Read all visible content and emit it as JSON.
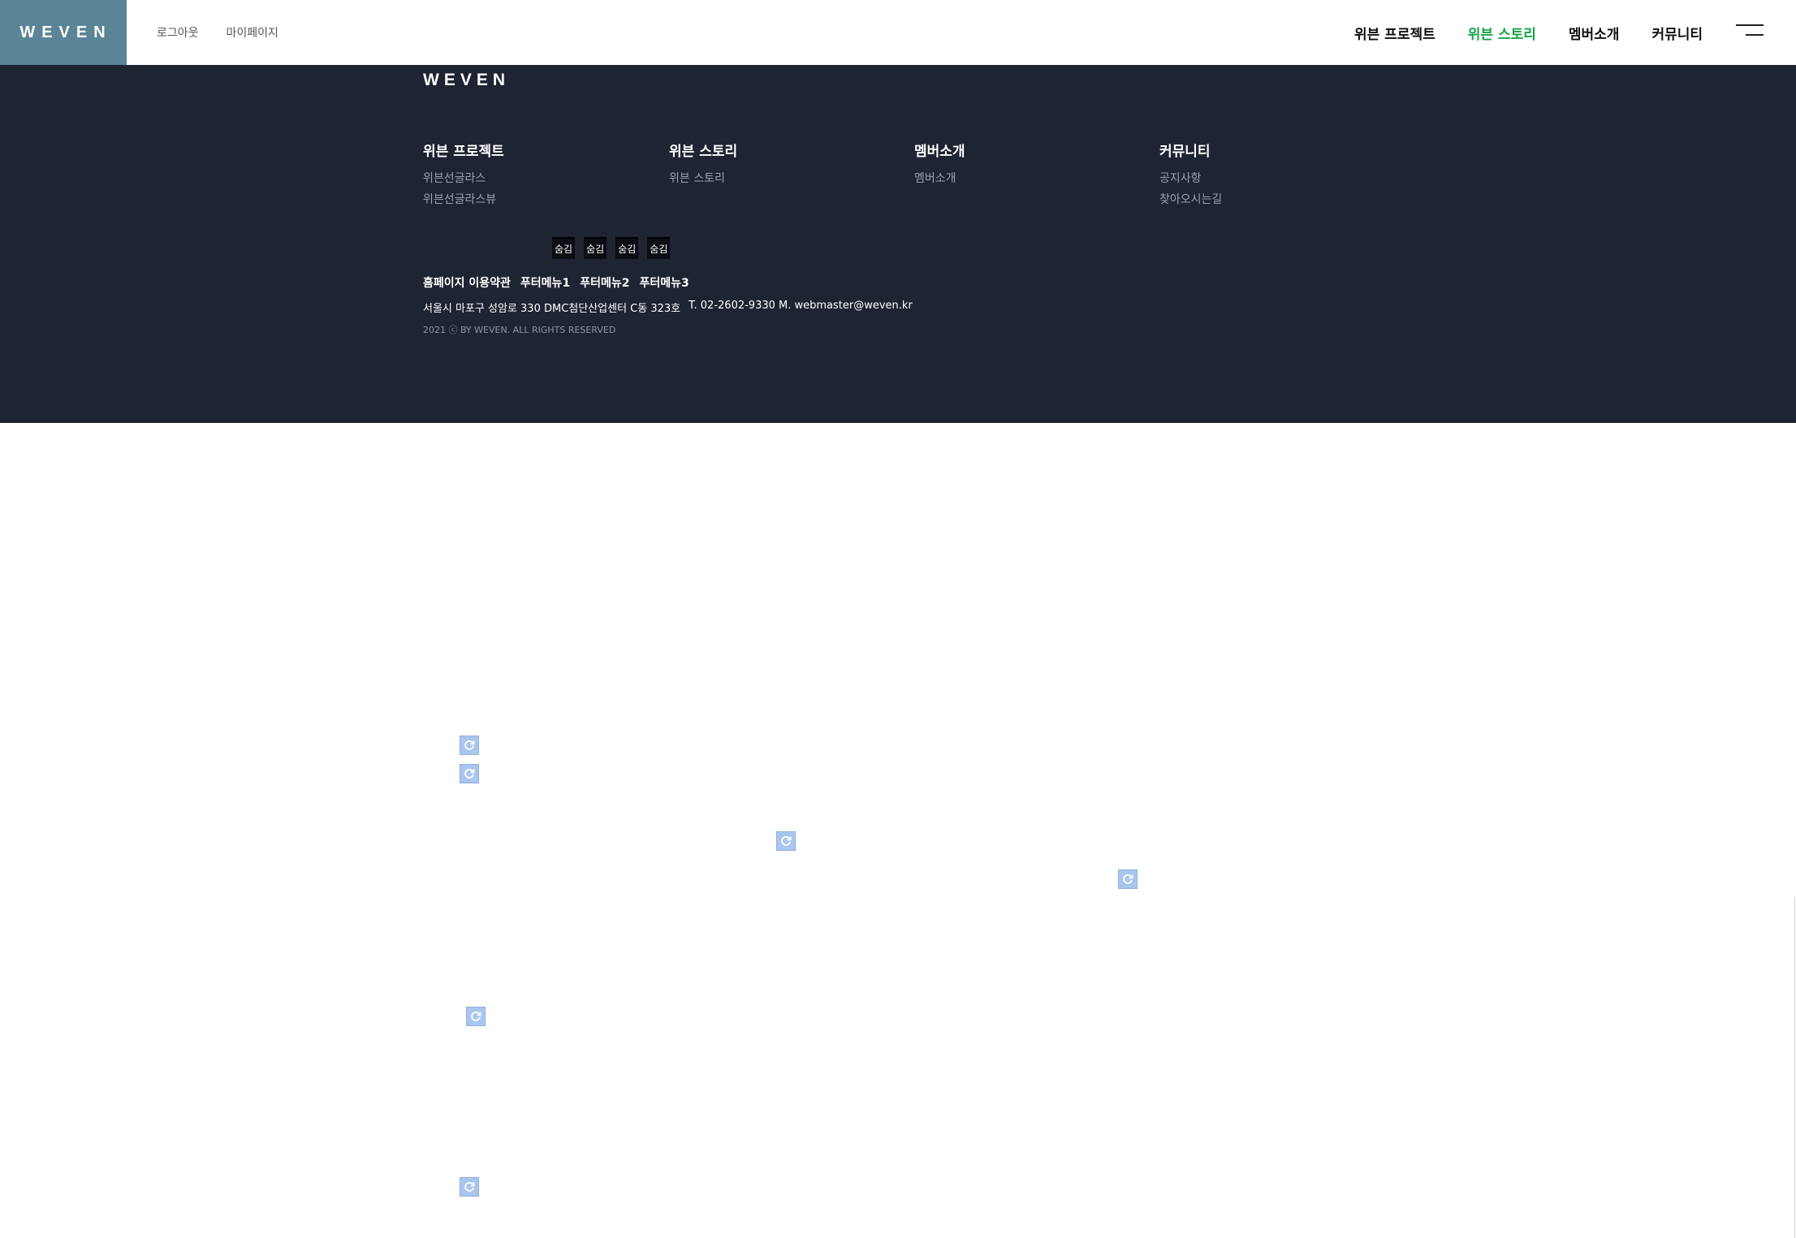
{
  "header": {
    "logo": "WEVEN",
    "util_links": [
      "로그아웃",
      "마이페이지"
    ],
    "nav": [
      {
        "label": "위븐 프로젝트",
        "active": false
      },
      {
        "label": "위븐 스토리",
        "active": true
      },
      {
        "label": "멤버소개",
        "active": false
      },
      {
        "label": "커뮤니티",
        "active": false
      }
    ],
    "active_color": "#1aa24a"
  },
  "footer": {
    "logo": "WEVEN",
    "columns": [
      {
        "title": "위븐 프로젝트",
        "links": [
          "위븐선글라스",
          "위븐선글라스뷰"
        ]
      },
      {
        "title": "위븐 스토리",
        "links": [
          "위븐 스토리"
        ]
      },
      {
        "title": "멤버소개",
        "links": [
          "멤버소개"
        ]
      },
      {
        "title": "커뮤니티",
        "links": [
          "공지사항",
          "찾아오시는길"
        ]
      }
    ],
    "hide_tags": [
      "숨김",
      "숨김",
      "숨김",
      "숨김"
    ],
    "menu": [
      "홈페이지 이용약관",
      "푸터메뉴1",
      "푸터메뉴2",
      "푸터메뉴3"
    ],
    "address": "서울시 마포구 성암로 330 DMC첨단산업센터 C동 323호",
    "contact": "T. 02-2602-9330 M. webmaster@weven.kr",
    "copyright": "2021 ⓒ BY WEVEN. ALL RIGHTS RESERVED",
    "background": "#1f2432"
  },
  "placeholders": {
    "icon": "reload-icon",
    "count": 6
  }
}
